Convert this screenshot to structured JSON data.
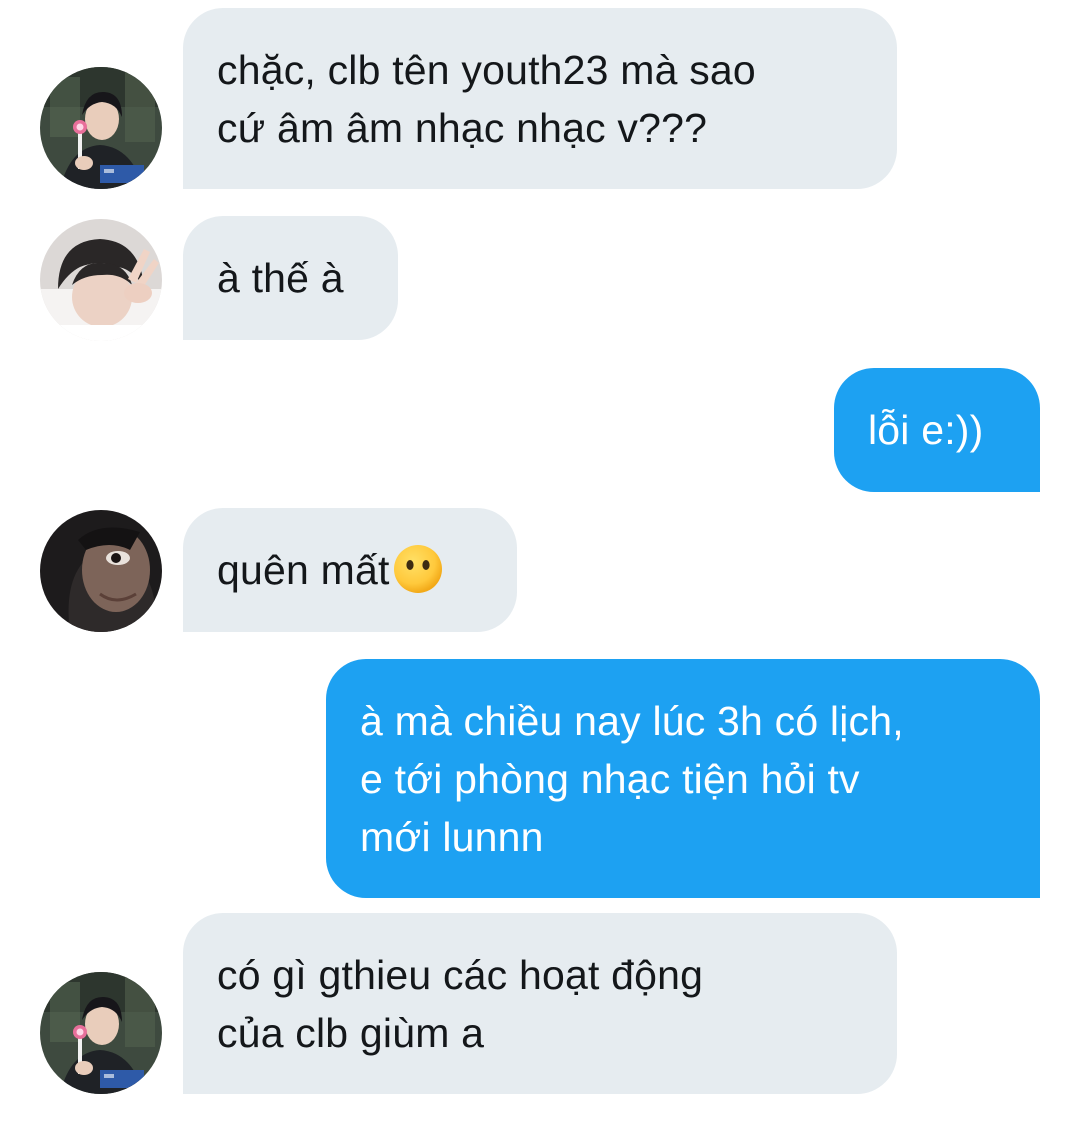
{
  "conversation": {
    "messages": [
      {
        "direction": "incoming",
        "avatar": "avatar-boy-holding-candy",
        "text": "chặc, clb tên youth23 mà sao\ncứ âm âm nhạc nhạc v???"
      },
      {
        "direction": "incoming",
        "avatar": "avatar-boy-peace-sign",
        "text": "à thế à"
      },
      {
        "direction": "outgoing",
        "text": "lỗi e:))"
      },
      {
        "direction": "incoming",
        "avatar": "avatar-boy-hooded-closeup",
        "text": "quên mất",
        "emoji": "face-without-mouth-emoji"
      },
      {
        "direction": "outgoing",
        "text": "à mà chiều nay lúc 3h có lịch,\ne tới phòng nhạc tiện hỏi tv\nmới lunnn"
      },
      {
        "direction": "incoming",
        "avatar": "avatar-boy-holding-candy",
        "text": "có gì gthieu các hoạt động\ncủa clb giùm a"
      }
    ]
  },
  "colors": {
    "incoming_bubble": "#e6ecf0",
    "outgoing_bubble": "#1da1f2",
    "incoming_text": "#14171a",
    "outgoing_text": "#ffffff",
    "background": "#ffffff"
  }
}
